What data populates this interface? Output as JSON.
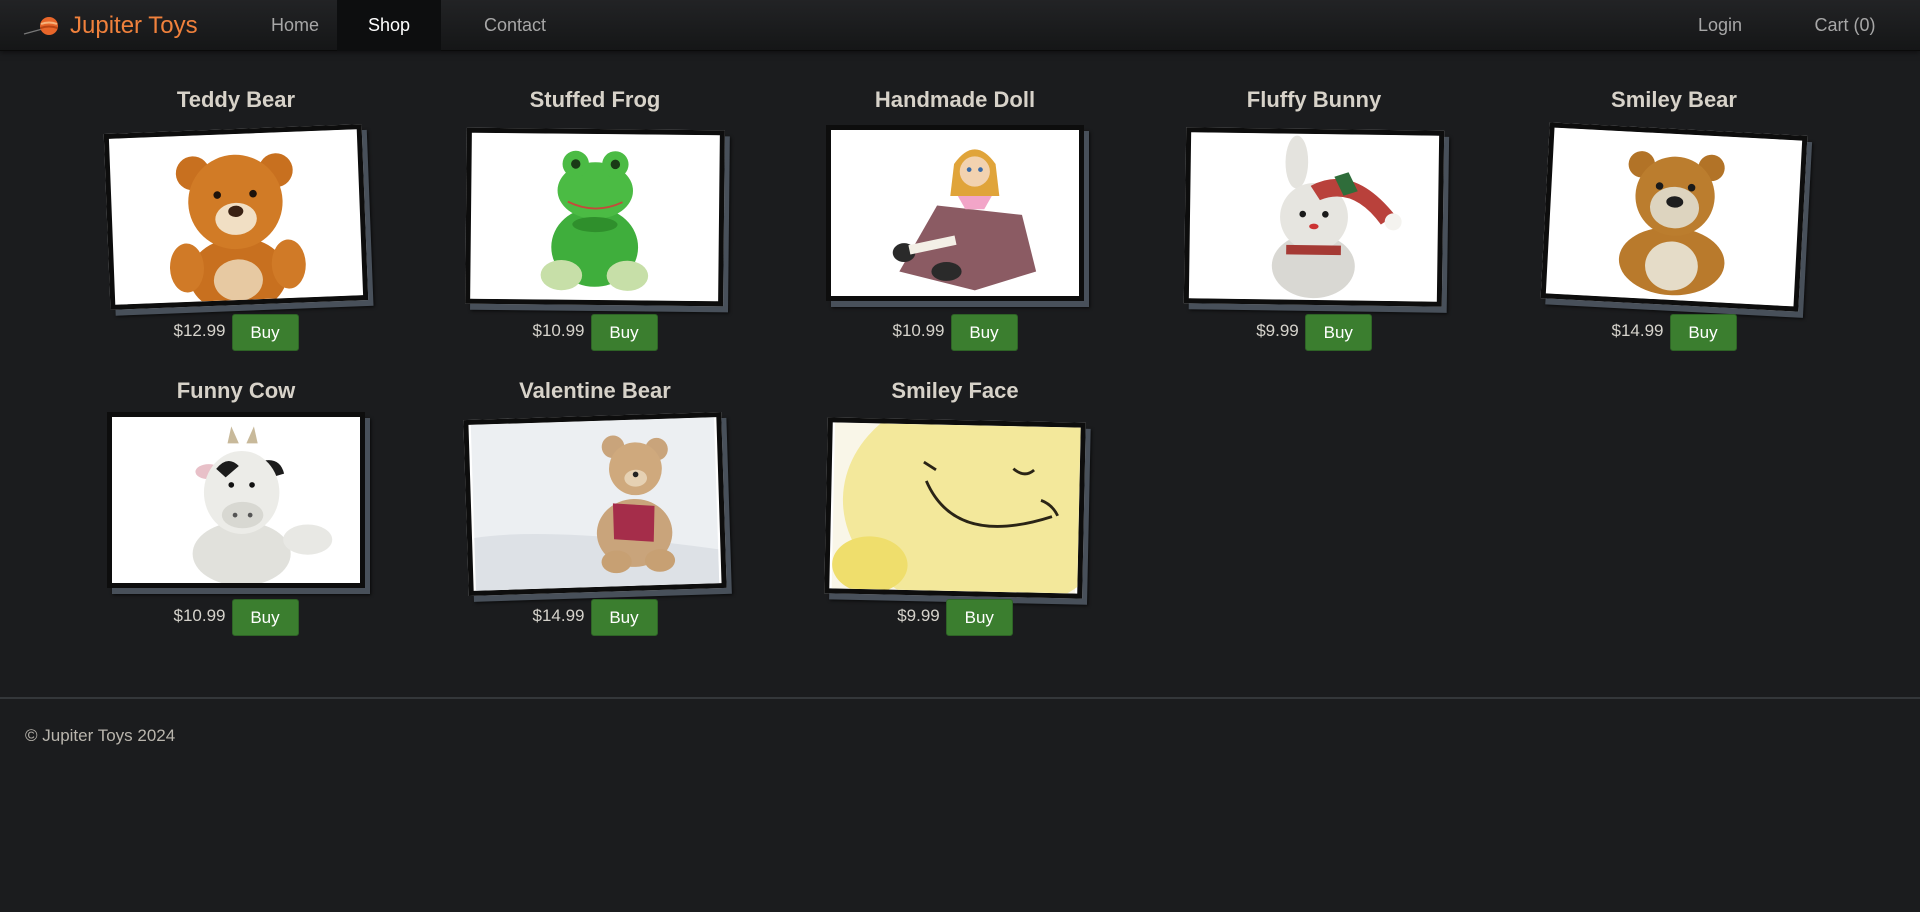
{
  "brand": {
    "name": "Jupiter Toys"
  },
  "nav": {
    "home": "Home",
    "shop": "Shop",
    "contact": "Contact",
    "login": "Login",
    "cart": "Cart (0)"
  },
  "products": [
    {
      "title": "Teddy Bear",
      "price": "$12.99",
      "buy": "Buy",
      "image": "teddy-bear-photo"
    },
    {
      "title": "Stuffed Frog",
      "price": "$10.99",
      "buy": "Buy",
      "image": "stuffed-frog-photo"
    },
    {
      "title": "Handmade Doll",
      "price": "$10.99",
      "buy": "Buy",
      "image": "handmade-doll-photo"
    },
    {
      "title": "Fluffy Bunny",
      "price": "$9.99",
      "buy": "Buy",
      "image": "fluffy-bunny-photo"
    },
    {
      "title": "Smiley Bear",
      "price": "$14.99",
      "buy": "Buy",
      "image": "smiley-bear-photo"
    },
    {
      "title": "Funny Cow",
      "price": "$10.99",
      "buy": "Buy",
      "image": "funny-cow-photo"
    },
    {
      "title": "Valentine Bear",
      "price": "$14.99",
      "buy": "Buy",
      "image": "valentine-bear-photo"
    },
    {
      "title": "Smiley Face",
      "price": "$9.99",
      "buy": "Buy",
      "image": "smiley-face-photo"
    }
  ],
  "footer": {
    "text": "© Jupiter Toys 2024"
  },
  "colors": {
    "brand": "#f0813c",
    "buy_button": "#3b7e2f",
    "background": "#1b1c1e"
  }
}
